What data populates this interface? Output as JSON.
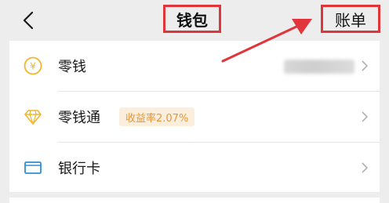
{
  "header": {
    "back_icon": "chevron-left-icon",
    "title": "钱包",
    "bill_label": "账单"
  },
  "colors": {
    "highlight_box": "#e0353b",
    "annotation_arrow": "#e0353b",
    "coin_icon": "#f2b52c",
    "diamond_icon": "#f2b52c",
    "card_icon": "#2e8fd6",
    "badge_bg": "#fbeedd",
    "badge_text": "#e2973d"
  },
  "menu": {
    "items": [
      {
        "label": "零钱",
        "icon": "coin-yuan-icon",
        "value": ""
      },
      {
        "label": "零钱通",
        "icon": "diamond-icon",
        "badge": "收益率2.07%"
      },
      {
        "label": "银行卡",
        "icon": "bank-card-icon"
      }
    ]
  }
}
